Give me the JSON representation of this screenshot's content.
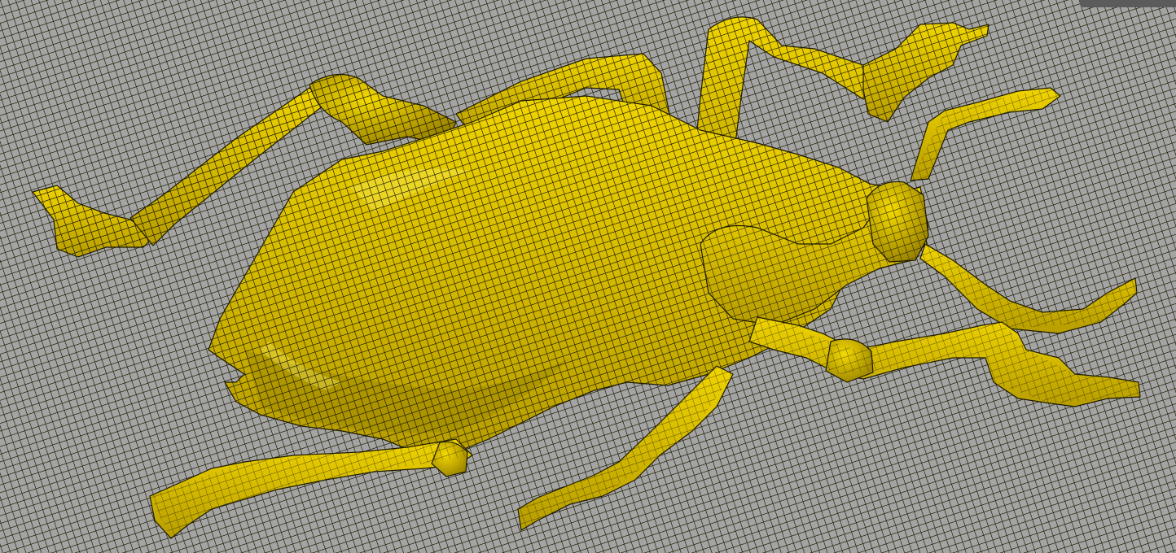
{
  "viewer": {
    "mesh_color": "#e5c800",
    "mesh_shadow_color": "#8a7700",
    "wire_color": "#1c1a00",
    "background_color": "#a4a4a4",
    "subject": "beetle-mesh"
  }
}
